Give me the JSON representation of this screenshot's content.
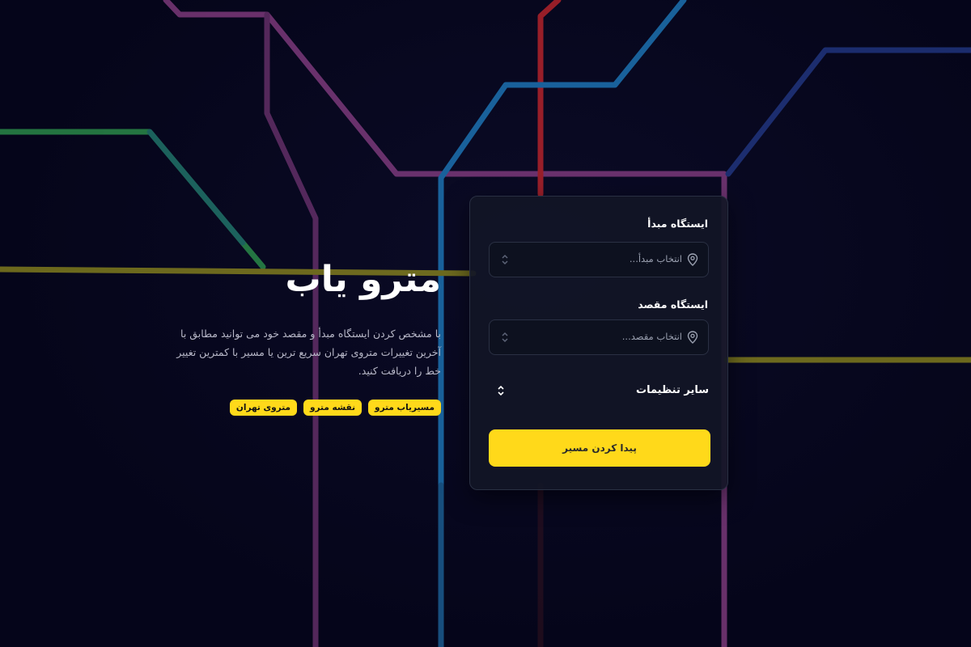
{
  "hero": {
    "title": "مترو یاب",
    "description": "با مشخص کردن ایستگاه مبدأ و مقصد خود می توانید مطابق با آخرین تغییرات متروی تهران سریع ترین یا مسیر با کمترین تغییر خط را دریافت کنید.",
    "tags": [
      "مسیریاب مترو",
      "نقشه مترو",
      "متروی تهران"
    ]
  },
  "form": {
    "origin_label": "ایستگاه مبدأ",
    "origin_placeholder": "انتخاب مبدأ...",
    "destination_label": "ایستگاه مقصد",
    "destination_placeholder": "انتخاب مقصد...",
    "settings_label": "سایر تنظیمات",
    "submit_label": "پیدا کردن مسیر"
  },
  "colors": {
    "background": "#06061a",
    "accent": "#ffd91a",
    "card": "#121626",
    "line_purple": "#8a3f86",
    "line_red": "#c8262c",
    "line_blue": "#1f7fc4",
    "line_navy": "#233a8a",
    "line_green": "#2e9a4e",
    "line_olive": "#8f8a1e",
    "line_teal": "#1c6f8a"
  },
  "icons": {
    "origin": "location-pin-icon",
    "destination": "location-pin-icon",
    "select_arrows": "updown-chevron-icon"
  }
}
